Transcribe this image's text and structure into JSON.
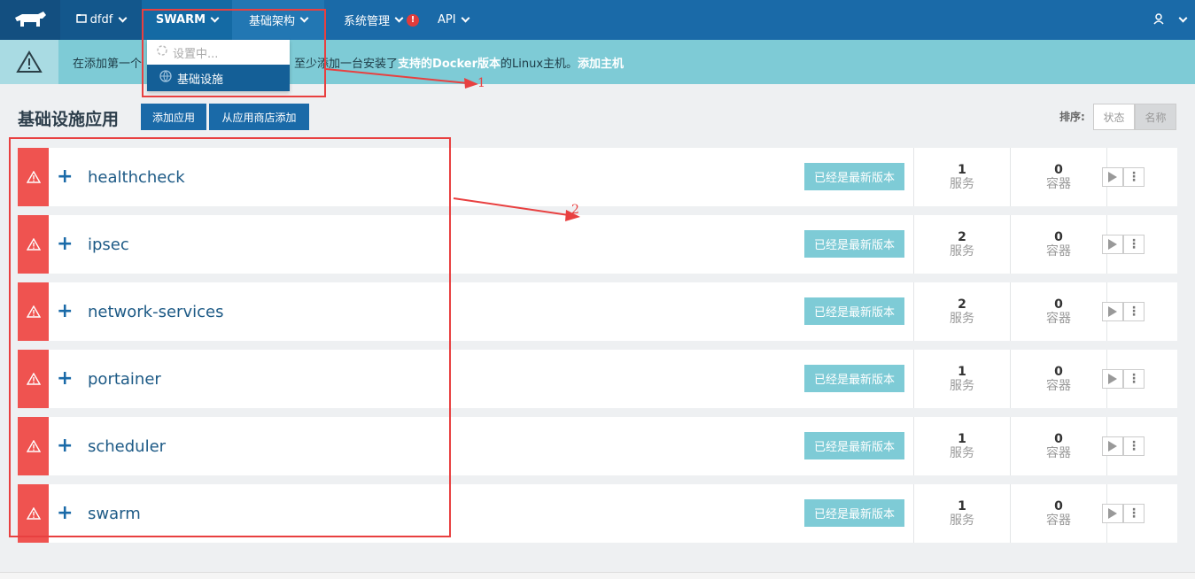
{
  "nav": {
    "env_name": "dfdf",
    "swarm_label": "SWARM",
    "infra_label": "基础架构",
    "admin_label": "系统管理",
    "admin_alert": "!",
    "api_label": "API"
  },
  "banner": {
    "text_before": "在添加第一个",
    "text_mid": "至少添加一台安装了",
    "link_docker": "支持的Docker版本",
    "text_after": " 的Linux主机。",
    "link_add_host": "添加主机"
  },
  "dropdown": {
    "loading_label": "设置中...",
    "active_label": "基础设施"
  },
  "header": {
    "title": "基础设施应用",
    "add_app_label": "添加应用",
    "add_from_store_label": "从应用商店添加",
    "sort_label": "排序:",
    "sort_state_label": "状态",
    "sort_name_label": "名称"
  },
  "stacks": [
    {
      "name": "healthcheck",
      "badge": "已经是最新版本",
      "services": "1",
      "services_label": "服务",
      "containers": "0",
      "containers_label": "容器"
    },
    {
      "name": "ipsec",
      "badge": "已经是最新版本",
      "services": "2",
      "services_label": "服务",
      "containers": "0",
      "containers_label": "容器"
    },
    {
      "name": "network-services",
      "badge": "已经是最新版本",
      "services": "2",
      "services_label": "服务",
      "containers": "0",
      "containers_label": "容器"
    },
    {
      "name": "portainer",
      "badge": "已经是最新版本",
      "services": "1",
      "services_label": "服务",
      "containers": "0",
      "containers_label": "容器"
    },
    {
      "name": "scheduler",
      "badge": "已经是最新版本",
      "services": "1",
      "services_label": "服务",
      "containers": "0",
      "containers_label": "容器"
    },
    {
      "name": "swarm",
      "badge": "已经是最新版本",
      "services": "1",
      "services_label": "服务",
      "containers": "0",
      "containers_label": "容器"
    }
  ],
  "annotations": {
    "label1": "1",
    "label2": "2"
  },
  "colors": {
    "nav": "#1a6aa8",
    "banner": "#7ecbd6",
    "warn": "#ef5350",
    "annotation": "#e84040"
  },
  "icons": [
    "rancher-logo-icon",
    "environment-icon",
    "chevron-down-icon",
    "warning-icon",
    "spinner-icon",
    "globe-icon",
    "user-icon",
    "plus-icon",
    "play-icon",
    "more-icon"
  ]
}
